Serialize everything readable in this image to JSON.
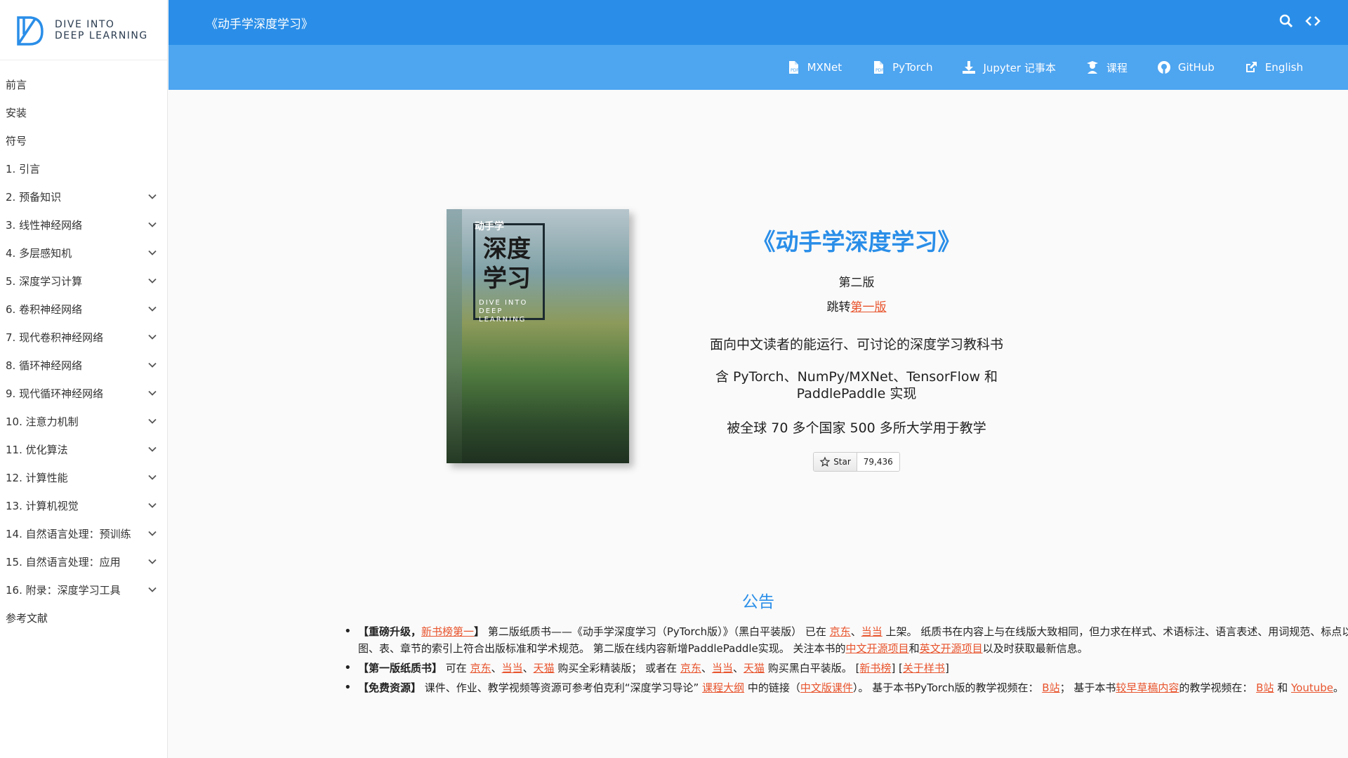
{
  "brand": {
    "line1": "DIVE INTO",
    "line2": "DEEP LEARNING"
  },
  "toc": [
    {
      "label": "前言",
      "expandable": false
    },
    {
      "label": "安装",
      "expandable": false
    },
    {
      "label": "符号",
      "expandable": false
    },
    {
      "label": "1. 引言",
      "expandable": false
    },
    {
      "label": "2. 预备知识",
      "expandable": true
    },
    {
      "label": "3. 线性神经网络",
      "expandable": true
    },
    {
      "label": "4. 多层感知机",
      "expandable": true
    },
    {
      "label": "5. 深度学习计算",
      "expandable": true
    },
    {
      "label": "6. 卷积神经网络",
      "expandable": true
    },
    {
      "label": "7. 现代卷积神经网络",
      "expandable": true
    },
    {
      "label": "8. 循环神经网络",
      "expandable": true
    },
    {
      "label": "9. 现代循环神经网络",
      "expandable": true
    },
    {
      "label": "10. 注意力机制",
      "expandable": true
    },
    {
      "label": "11. 优化算法",
      "expandable": true
    },
    {
      "label": "12. 计算性能",
      "expandable": true
    },
    {
      "label": "13. 计算机视觉",
      "expandable": true
    },
    {
      "label": "14. 自然语言处理：预训练",
      "expandable": true
    },
    {
      "label": "15. 自然语言处理：应用",
      "expandable": true
    },
    {
      "label": "16. 附录：深度学习工具",
      "expandable": true
    },
    {
      "label": "参考文献",
      "expandable": false
    }
  ],
  "topbar": {
    "title": "《动手学深度学习》"
  },
  "nav": [
    {
      "label": "MXNet",
      "icon": "pdf-icon"
    },
    {
      "label": "PyTorch",
      "icon": "pdf-icon"
    },
    {
      "label": "Jupyter 记事本",
      "icon": "download-icon"
    },
    {
      "label": "课程",
      "icon": "graduation-icon"
    },
    {
      "label": "GitHub",
      "icon": "github-icon"
    },
    {
      "label": "English",
      "icon": "external-link-icon"
    }
  ],
  "cover": {
    "top": "动手学",
    "main1": "深度",
    "main2": "学习",
    "sub1": "DIVE INTO",
    "sub2": "DEEP",
    "sub3": "LEARNING"
  },
  "hero": {
    "title": "《动手学深度学习》",
    "edition": "第二版",
    "jump_prefix": "跳转",
    "jump_link": "第一版",
    "desc": "面向中文读者的能运行、可讨论的深度学习教科书",
    "impl": "含 PyTorch、NumPy/MXNet、TensorFlow 和 PaddlePaddle 实现",
    "usage": "被全球 70 多个国家 500 多所大学用于教学",
    "star_label": "Star",
    "star_count": "79,436"
  },
  "announce": {
    "title": "公告",
    "item1": {
      "b1": "【重磅升级，",
      "l1": "新书榜第一",
      "b2": "】",
      "t1": " 第二版纸质书——《动手学深度学习（PyTorch版）》（黑白平装版） 已在 ",
      "l2": "京东",
      "sep1": "、",
      "l3": "当当",
      "t2": " 上架。 纸质书在内容上与在线版大致相同，但力求在样式、术语标注、语言表述、用词规范、标点以及图、表、章节的索引上符合出版标准和学术规范。 第二版在线内容新增PaddlePaddle实现。 关注本书的",
      "l4": "中文开源项目",
      "t3": "和",
      "l5": "英文开源项目",
      "t4": "以及时获取最新信息。"
    },
    "item2": {
      "b1": "【第一版纸质书】",
      "t1": " 可在 ",
      "l1": "京东",
      "sep1": "、",
      "l2": "当当",
      "sep2": "、",
      "l3": "天猫",
      "t2": " 购买全彩精装版； 或者在 ",
      "l4": "京东",
      "sep3": "、",
      "l5": "当当",
      "sep4": "、",
      "l6": "天猫",
      "t3": " 购买黑白平装版。 [",
      "l7": "新书榜",
      "t4": "] [",
      "l8": "关于样书",
      "t5": "]"
    },
    "item3": {
      "b1": "【免费资源】",
      "t1": " 课件、作业、教学视频等资源可参考伯克利“深度学习导论” ",
      "l1": "课程大纲",
      "t2": " 中的链接（",
      "l2": "中文版课件",
      "t3": "）。 基于本书PyTorch版的教学视频在： ",
      "l3": "B站",
      "t4": "； 基于本书",
      "l4": "较早草稿内容",
      "t5": "的教学视频在： ",
      "l5": "B站",
      "t6": " 和 ",
      "l6": "Youtube",
      "t7": "。"
    }
  },
  "colors": {
    "header": "#2a8ee8",
    "nav": "#4ea5f0",
    "link": "#e8542d"
  }
}
